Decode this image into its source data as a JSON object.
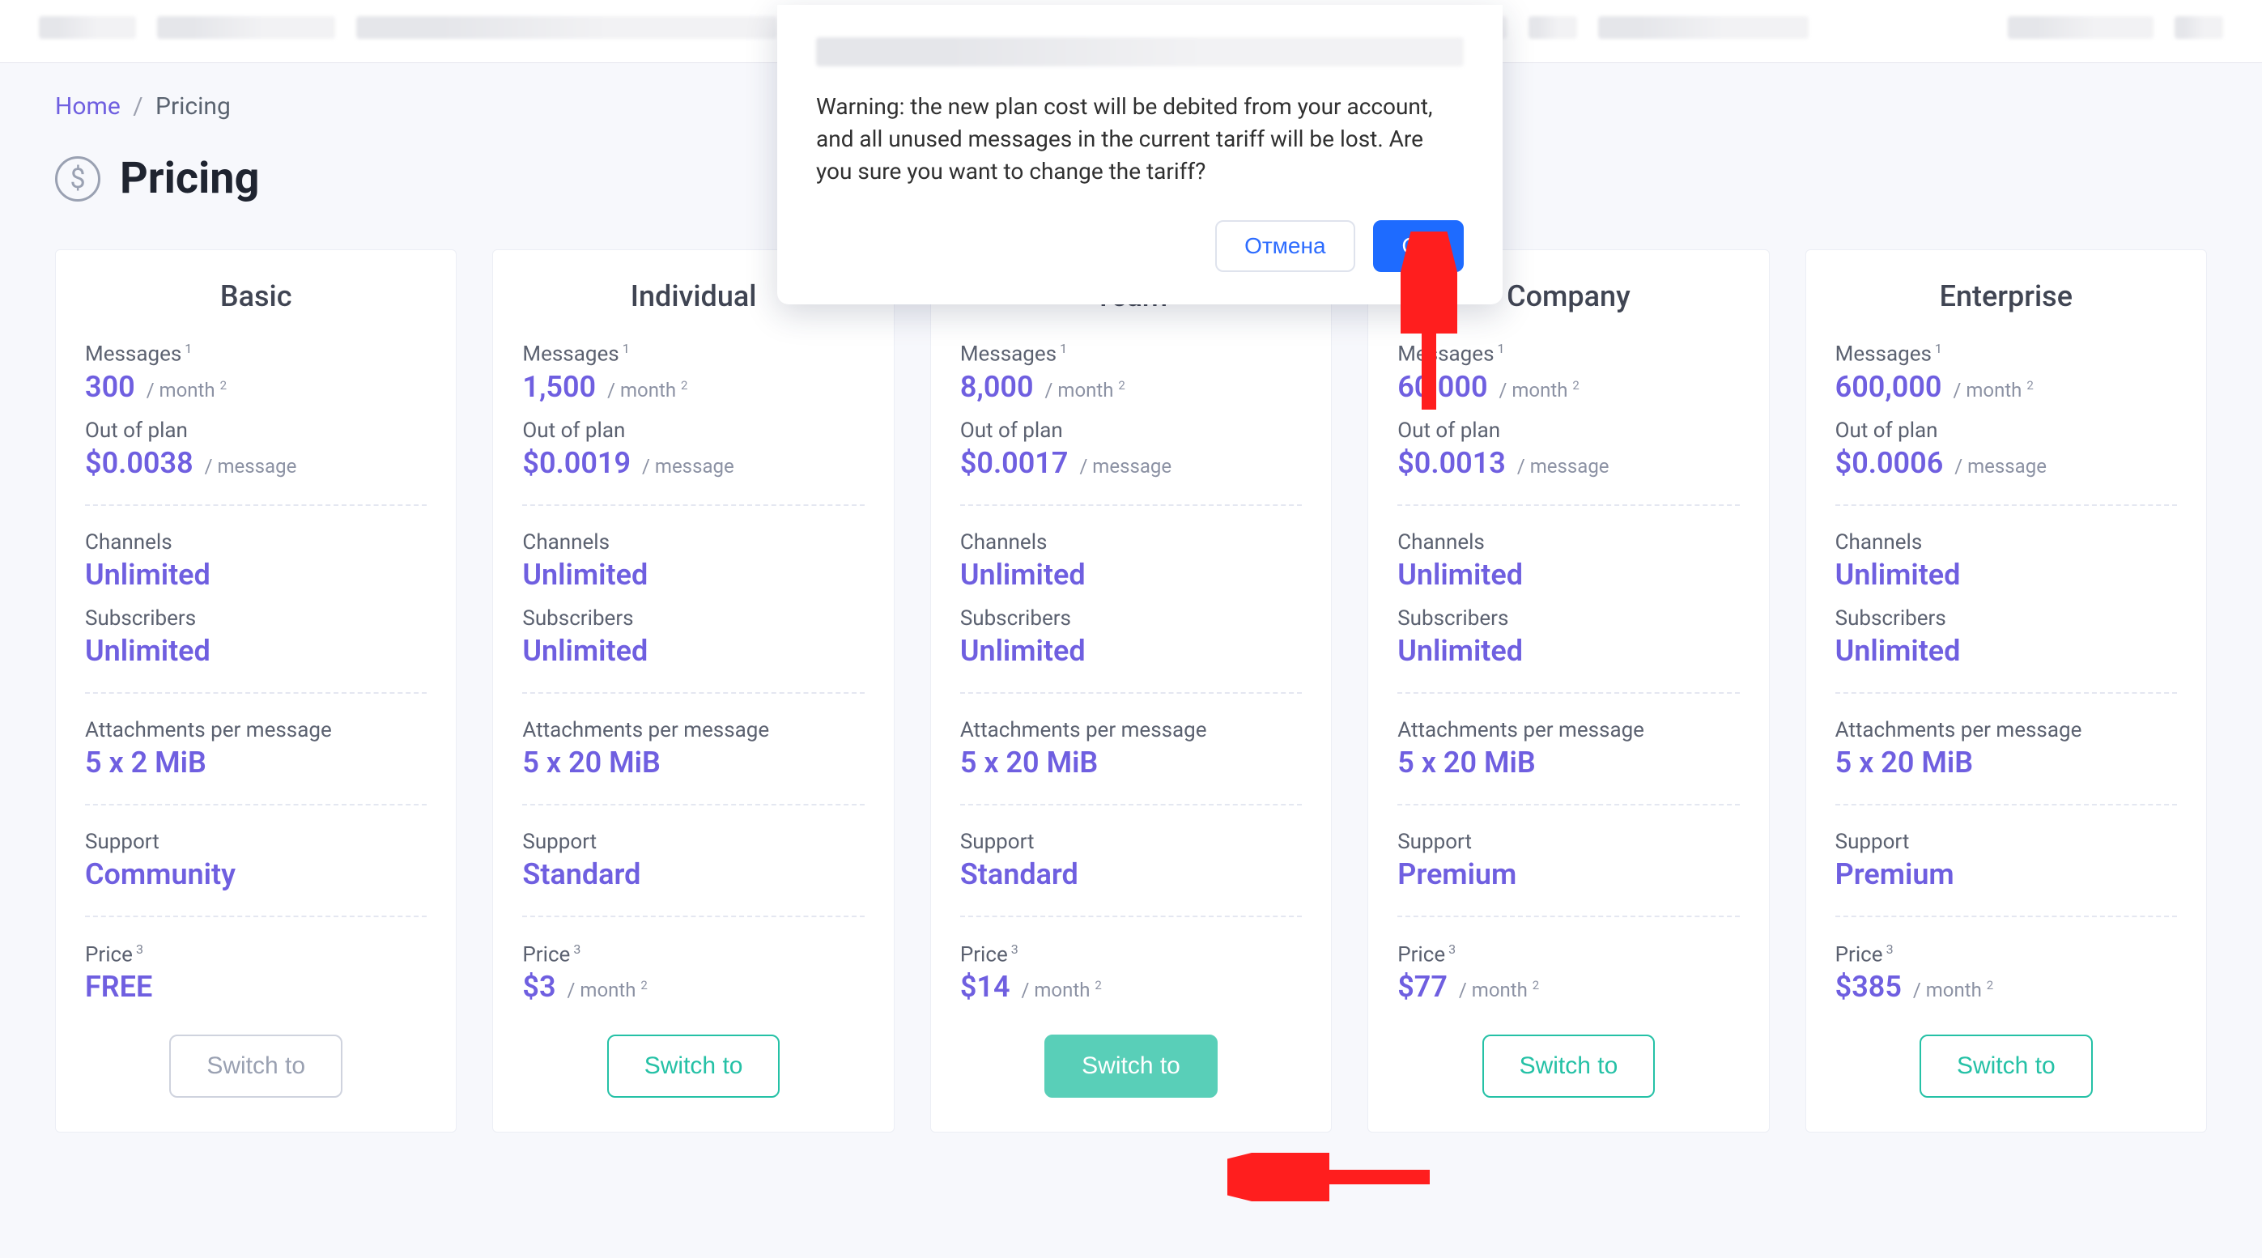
{
  "breadcrumb": {
    "home": "Home",
    "sep": "/",
    "current": "Pricing"
  },
  "page_title": "Pricing",
  "modal": {
    "text": "Warning: the new plan cost will be debited from your account, and all unused messages in the current tariff will be lost. Are you sure you want to change the tariff?",
    "cancel": "Отмена",
    "ok": "OK"
  },
  "common": {
    "messages_label": "Messages",
    "out_of_plan_label": "Out of plan",
    "channels_label": "Channels",
    "subscribers_label": "Subscribers",
    "attachments_label": "Attachments per message",
    "support_label": "Support",
    "price_label": "Price",
    "per_month": "/ month",
    "per_message": "/ message",
    "switch_label": "Switch to"
  },
  "plans": [
    {
      "key": "basic",
      "name": "Basic",
      "messages": "300",
      "out_of_plan": "$0.0038",
      "channels": "Unlimited",
      "subscribers": "Unlimited",
      "attachments": "5 x 2 MiB",
      "support": "Community",
      "price": "FREE",
      "price_suffix_hidden": true,
      "btn_state": "disabled"
    },
    {
      "key": "individual",
      "name": "Individual",
      "messages": "1,500",
      "out_of_plan": "$0.0019",
      "channels": "Unlimited",
      "subscribers": "Unlimited",
      "attachments": "5 x 20 MiB",
      "support": "Standard",
      "price": "$3",
      "btn_state": "normal"
    },
    {
      "key": "team",
      "name": "Team",
      "messages": "8,000",
      "out_of_plan": "$0.0017",
      "channels": "Unlimited",
      "subscribers": "Unlimited",
      "attachments": "5 x 20 MiB",
      "support": "Standard",
      "price": "$14",
      "btn_state": "active"
    },
    {
      "key": "company",
      "name": "Company",
      "messages": "60,000",
      "out_of_plan": "$0.0013",
      "channels": "Unlimited",
      "subscribers": "Unlimited",
      "attachments": "5 x 20 MiB",
      "support": "Premium",
      "price": "$77",
      "btn_state": "normal"
    },
    {
      "key": "enterprise",
      "name": "Enterprise",
      "messages": "600,000",
      "out_of_plan": "$0.0006",
      "channels": "Unlimited",
      "subscribers": "Unlimited",
      "attachments": "5 x 20 MiB",
      "support": "Premium",
      "price": "$385",
      "btn_state": "normal"
    }
  ]
}
